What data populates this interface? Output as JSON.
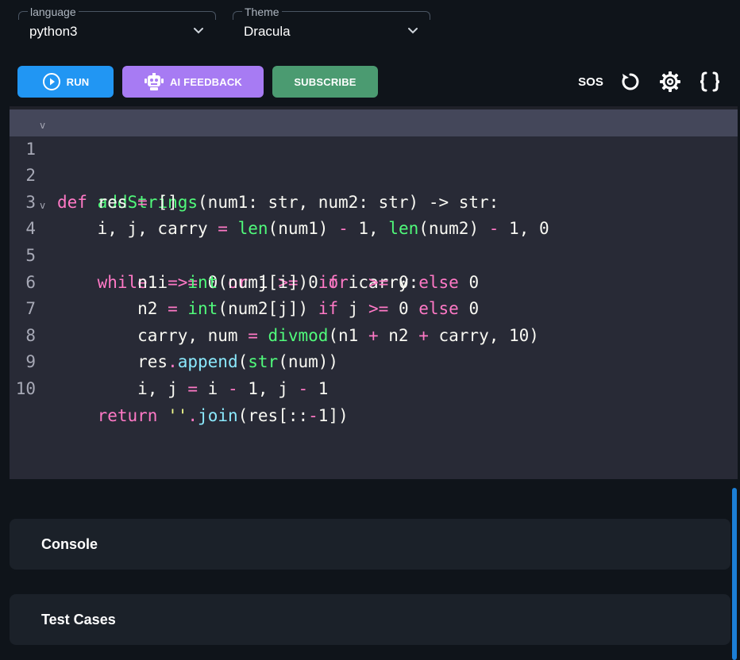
{
  "toolbar": {
    "language": {
      "label": "language",
      "value": "python3"
    },
    "theme": {
      "label": "Theme",
      "value": "Dracula"
    },
    "run_label": "RUN",
    "ai_feedback_label": "AI FEEDBACK",
    "subscribe_label": "SUBSCRIBE",
    "sos_label": "SOS",
    "colors": {
      "run": "#2196f3",
      "ai_feedback": "#a77bf3",
      "subscribe": "#4b9b71"
    }
  },
  "editor": {
    "line_numbers": [
      "1",
      "2",
      "3",
      "4",
      "5",
      "6",
      "7",
      "8",
      "9",
      "10"
    ],
    "lines": [
      "def addStrings(num1: str, num2: str) -> str:",
      "    res = []",
      "    i, j, carry = len(num1) - 1, len(num2) - 1, 0",
      "    while i >= 0 or j >= 0 or carry:",
      "        n1 = int(num1[i]) if i >= 0 else 0",
      "        n2 = int(num2[j]) if j >= 0 else 0",
      "        carry, num = divmod(n1 + n2 + carry, 10)",
      "        res.append(str(num))",
      "        i, j = i - 1, j - 1",
      "    return ''.join(res[::-1])"
    ]
  },
  "panels": {
    "console_title": "Console",
    "test_cases_title": "Test Cases"
  }
}
